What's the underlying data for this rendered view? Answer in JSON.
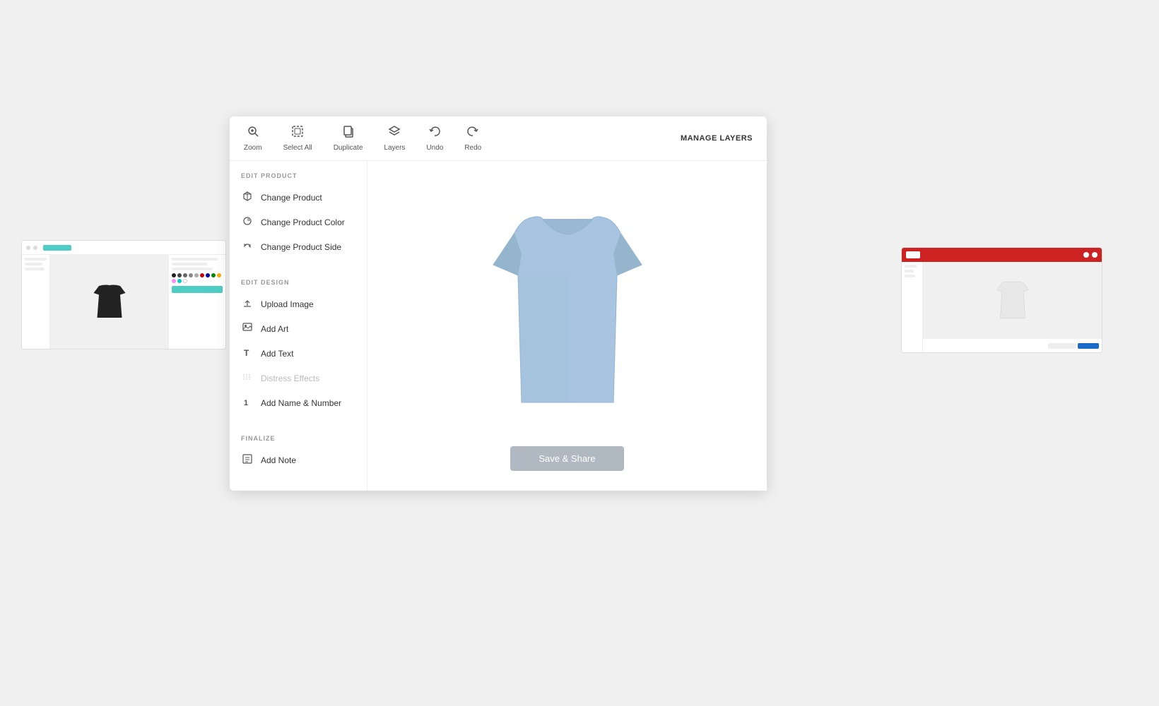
{
  "background": {
    "color": "#f0f0f0"
  },
  "modal": {
    "toolbar": {
      "items": [
        {
          "id": "zoom",
          "label": "Zoom",
          "icon": "🔍"
        },
        {
          "id": "select-all",
          "label": "Select All",
          "icon": "⊞"
        },
        {
          "id": "duplicate",
          "label": "Duplicate",
          "icon": "❐"
        },
        {
          "id": "layers",
          "label": "Layers",
          "icon": "◈"
        },
        {
          "id": "undo",
          "label": "Undo",
          "icon": "↩"
        },
        {
          "id": "redo",
          "label": "Redo",
          "icon": "↪"
        }
      ],
      "manage_layers": "MANAGE LAYERS"
    },
    "sidebar": {
      "edit_product_label": "EDIT PRODUCT",
      "items_product": [
        {
          "id": "change-product",
          "label": "Change Product",
          "icon": "🏷"
        },
        {
          "id": "change-product-color",
          "label": "Change Product Color",
          "icon": "🎨"
        },
        {
          "id": "change-product-side",
          "label": "Change Product Side",
          "icon": "🔄"
        }
      ],
      "edit_design_label": "EDIT DESIGN",
      "items_design": [
        {
          "id": "upload-image",
          "label": "Upload Image",
          "icon": "⬆"
        },
        {
          "id": "add-art",
          "label": "Add Art",
          "icon": "🖼"
        },
        {
          "id": "add-text",
          "label": "Add Text",
          "icon": "T"
        },
        {
          "id": "distress-effects",
          "label": "Distress Effects",
          "icon": "≋",
          "disabled": true
        },
        {
          "id": "add-name-number",
          "label": "Add Name & Number",
          "icon": "1"
        }
      ],
      "finalize_label": "FINALIZE",
      "items_finalize": [
        {
          "id": "add-note",
          "label": "Add Note",
          "icon": "📋"
        }
      ]
    },
    "canvas": {
      "save_share_button": "Save & Share"
    }
  },
  "thumbnail_colors": {
    "left_shirt": "#222",
    "right_shirt": "#e8e8e8"
  }
}
